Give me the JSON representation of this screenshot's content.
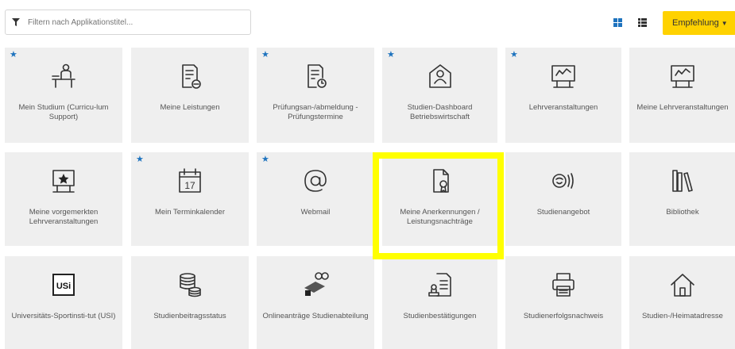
{
  "filter": {
    "placeholder": "Filtern nach Applikationstitel..."
  },
  "toolbar": {
    "recommend_label": "Empfehlung",
    "grid_view": "grid-view-icon",
    "list_view": "list-view-icon"
  },
  "colors": {
    "accent": "#ffd200",
    "star": "#1e73be",
    "highlight": "#ffff00",
    "tile": "#efefef"
  },
  "tiles": [
    {
      "label": "Mein Studium (Curricu-lum Support)",
      "starred": true,
      "icon": "student-desk-icon"
    },
    {
      "label": "Meine Leistungen",
      "starred": false,
      "icon": "grades-list-icon"
    },
    {
      "label": "Prüfungsan-/abmeldung - Prüfungstermine",
      "starred": true,
      "icon": "exam-registration-icon"
    },
    {
      "label": "Studien-Dashboard Betriebswirtschaft",
      "starred": true,
      "icon": "dashboard-person-icon"
    },
    {
      "label": "Lehrveranstaltungen",
      "starred": true,
      "icon": "courses-board-icon"
    },
    {
      "label": "Meine Lehrveranstaltungen",
      "starred": false,
      "icon": "my-courses-board-icon"
    },
    {
      "label": "Meine vorgemerkten Lehrveranstaltungen",
      "starred": false,
      "icon": "bookmarked-courses-icon"
    },
    {
      "label": "Mein Terminkalender",
      "starred": true,
      "icon": "calendar-icon",
      "day": "17"
    },
    {
      "label": "Webmail",
      "starred": true,
      "icon": "at-sign-icon"
    },
    {
      "label": "Meine Anerkennungen / Leistungsnachträge",
      "starred": false,
      "icon": "certificate-document-icon"
    },
    {
      "label": "Studienangebot",
      "starred": false,
      "icon": "study-offer-icon"
    },
    {
      "label": "Bibliothek",
      "starred": false,
      "icon": "library-books-icon"
    },
    {
      "label": "Universitäts-Sportinsti-tut (USI)",
      "starred": false,
      "icon": "usi-logo-icon",
      "badge": "USi"
    },
    {
      "label": "Studienbeitragsstatus",
      "starred": false,
      "icon": "coins-stack-icon"
    },
    {
      "label": "Onlineanträge Studienabteilung",
      "starred": false,
      "icon": "online-applications-icon"
    },
    {
      "label": "Studienbestätigungen",
      "starred": false,
      "icon": "confirmation-stamp-icon"
    },
    {
      "label": "Studienerfolgsnachweis",
      "starred": false,
      "icon": "printer-icon"
    },
    {
      "label": "Studien-/Heimatadresse",
      "starred": false,
      "icon": "home-icon"
    }
  ]
}
